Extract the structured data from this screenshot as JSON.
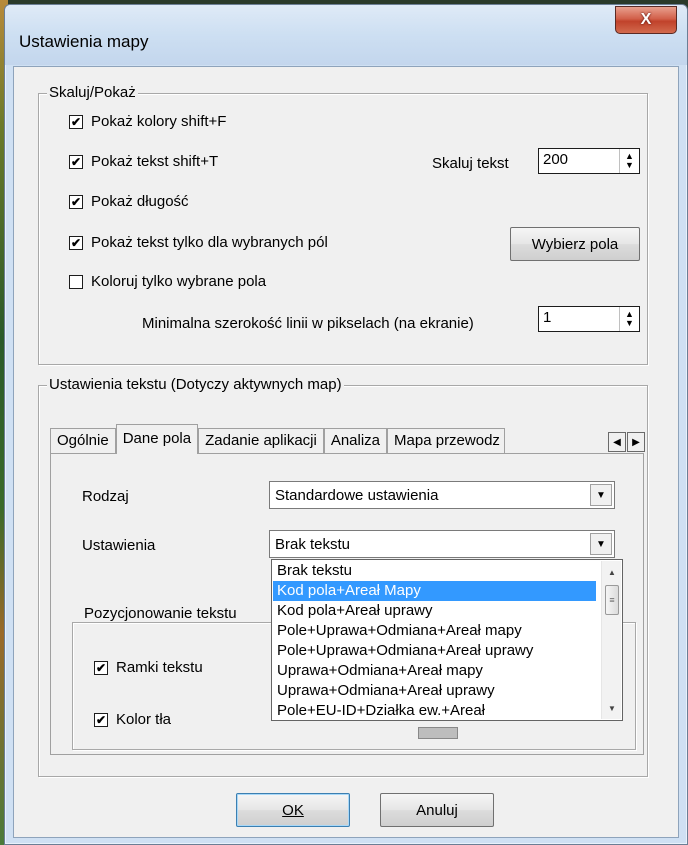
{
  "window": {
    "title": "Ustawienia mapy",
    "close_label": "X"
  },
  "scale_group": {
    "legend": "Skaluj/Pokaż",
    "show_colors": {
      "label": "Pokaż kolory shift+F",
      "checked": true
    },
    "show_text": {
      "label": "Pokaż tekst  shift+T",
      "checked": true
    },
    "show_length": {
      "label": "Pokaż długość",
      "checked": true
    },
    "show_text_selected": {
      "label": "Pokaż tekst tylko dla wybranych pól",
      "checked": true
    },
    "color_selected": {
      "label": "Koloruj tylko wybrane pola",
      "checked": false
    },
    "scale_text_label": "Skaluj tekst",
    "scale_text_value": "200",
    "select_fields_button": "Wybierz pola",
    "min_line_width_label": "Minimalna szerokość linii w pikselach (na ekranie)",
    "min_line_width_value": "1"
  },
  "text_group": {
    "legend": "Ustawienia tekstu  (Dotyczy aktywnych map)",
    "tabs": [
      "Ogólnie",
      "Dane pola",
      "Zadanie aplikacji",
      "Analiza",
      "Mapa przewodz"
    ],
    "active_tab": "Dane pola",
    "rodzaj_label": "Rodzaj",
    "rodzaj_value": "Standardowe ustawienia",
    "ustawienia_label": "Ustawienia",
    "ustawienia_value": "Brak tekstu",
    "position_label": "Pozycjonowanie tekstu",
    "frames": {
      "label": "Ramki tekstu",
      "checked": true
    },
    "bg_color": {
      "label": "Kolor tła",
      "checked": true
    },
    "dropdown_options": [
      "Brak tekstu",
      "Kod pola+Areał Mapy",
      "Kod pola+Areał uprawy",
      "Pole+Uprawa+Odmiana+Areał mapy",
      "Pole+Uprawa+Odmiana+Areał uprawy",
      "Uprawa+Odmiana+Areał mapy",
      "Uprawa+Odmiana+Areał uprawy",
      "Pole+EU-ID+Działka ew.+Areał"
    ],
    "dropdown_selected_index": 1
  },
  "buttons": {
    "ok": "OK",
    "cancel": "Anuluj"
  }
}
